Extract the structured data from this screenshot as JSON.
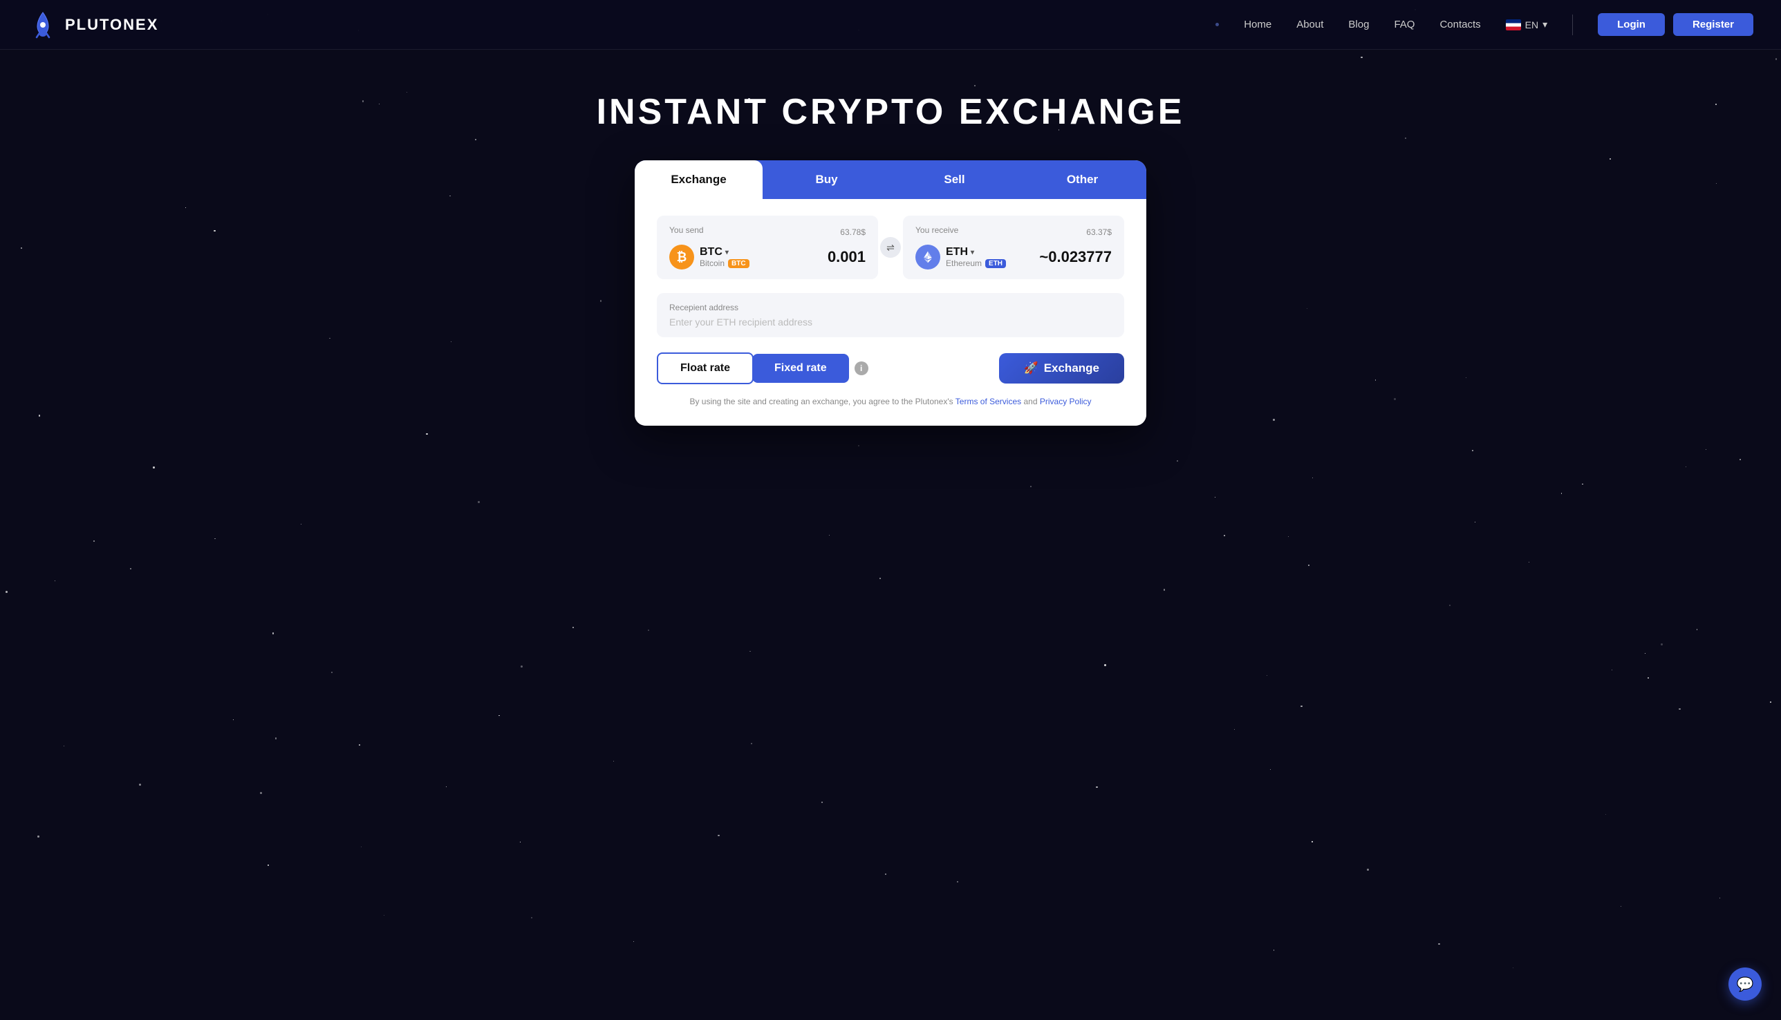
{
  "brand": {
    "name": "PLUTONEX",
    "logo_emoji": "🚀"
  },
  "nav": {
    "dot": "·",
    "links": [
      "Home",
      "About",
      "Blog",
      "FAQ",
      "Contacts"
    ],
    "lang": "EN",
    "login_label": "Login",
    "register_label": "Register"
  },
  "hero": {
    "title": "INSTANT CRYPTO EXCHANGE"
  },
  "tabs": [
    {
      "id": "exchange",
      "label": "Exchange",
      "active": true
    },
    {
      "id": "buy",
      "label": "Buy",
      "active": false
    },
    {
      "id": "sell",
      "label": "Sell",
      "active": false
    },
    {
      "id": "other",
      "label": "Other",
      "active": false
    }
  ],
  "send_panel": {
    "label": "You send",
    "value": "63.78$",
    "coin_ticker": "BTC",
    "coin_chevron": "▾",
    "coin_fullname": "Bitcoin",
    "coin_badge": "BTC",
    "amount": "0.001"
  },
  "receive_panel": {
    "label": "You receive",
    "value": "63.37$",
    "coin_ticker": "ETH",
    "coin_chevron": "▾",
    "coin_fullname": "Ethereum",
    "coin_badge": "ETH",
    "amount": "~0.023777"
  },
  "swap_icon": "⇌",
  "address": {
    "label": "Recepient address",
    "placeholder": "Enter your ETH recipient address"
  },
  "rate_buttons": {
    "float_label": "Float rate",
    "fixed_label": "Fixed rate",
    "info_icon": "i"
  },
  "exchange_button": {
    "icon": "🚀",
    "label": "Exchange"
  },
  "disclaimer": {
    "text_before": "By using the site and creating an exchange, you agree to the Plutonex's",
    "terms_label": "Terms of Services",
    "text_middle": "and",
    "privacy_label": "Privacy Policy"
  },
  "chat_icon": "💬"
}
